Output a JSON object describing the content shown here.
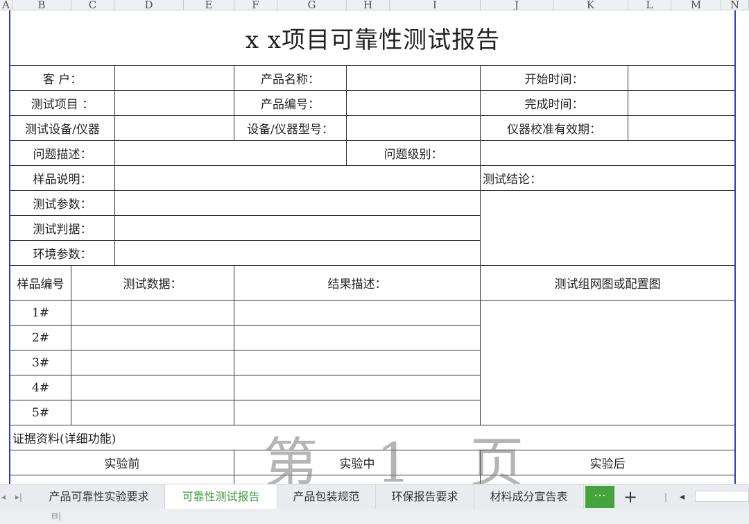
{
  "columns": [
    "A",
    "B",
    "C",
    "D",
    "E",
    "F",
    "G",
    "H",
    "I",
    "J",
    "K",
    "L",
    "M",
    "N"
  ],
  "title": "x  x项目可靠性测试报告",
  "info": {
    "customer": "客    户：",
    "product_name": "产品名称：",
    "start_time": "开始时间：",
    "test_item": "测试项目 ：",
    "product_no": "产品编号：",
    "finish_time": "完成时间：",
    "equipment": "测试设备/仪器",
    "equipment_model": "设备/仪器型号：",
    "calibration": "仪器校准有效期：",
    "problem_desc": "问题描述：",
    "problem_level": "问题级别：",
    "sample_desc": "样品说明：",
    "test_conclusion": "测试结论：",
    "test_params": "测试参数：",
    "test_criteria": "测试判据：",
    "env_params": "环境参数："
  },
  "table": {
    "sample_no": "样品编号",
    "test_data": "测试数据：",
    "result_desc": "结果描述：",
    "diagram": "测试组网图或配置图",
    "rows": [
      "1#",
      "2#",
      "3#",
      "4#",
      "5#"
    ]
  },
  "evidence": {
    "label": "证据资料(详细功能)",
    "before": "实验前",
    "during": "实验中",
    "after": "实验后"
  },
  "watermark": "第 1 页",
  "tabs": [
    {
      "label": "产品可靠性实验要求",
      "active": false
    },
    {
      "label": "可靠性测试报告",
      "active": true
    },
    {
      "label": "产品包装规范",
      "active": false
    },
    {
      "label": "环保报告要求",
      "active": false
    },
    {
      "label": "材料成分宣告表",
      "active": false
    }
  ],
  "more_label": "···",
  "add_label": "+",
  "colors": {
    "active_tab_text": "#3a9a3f",
    "more_button": "#44a33a",
    "frame": "#2b3fbf"
  }
}
